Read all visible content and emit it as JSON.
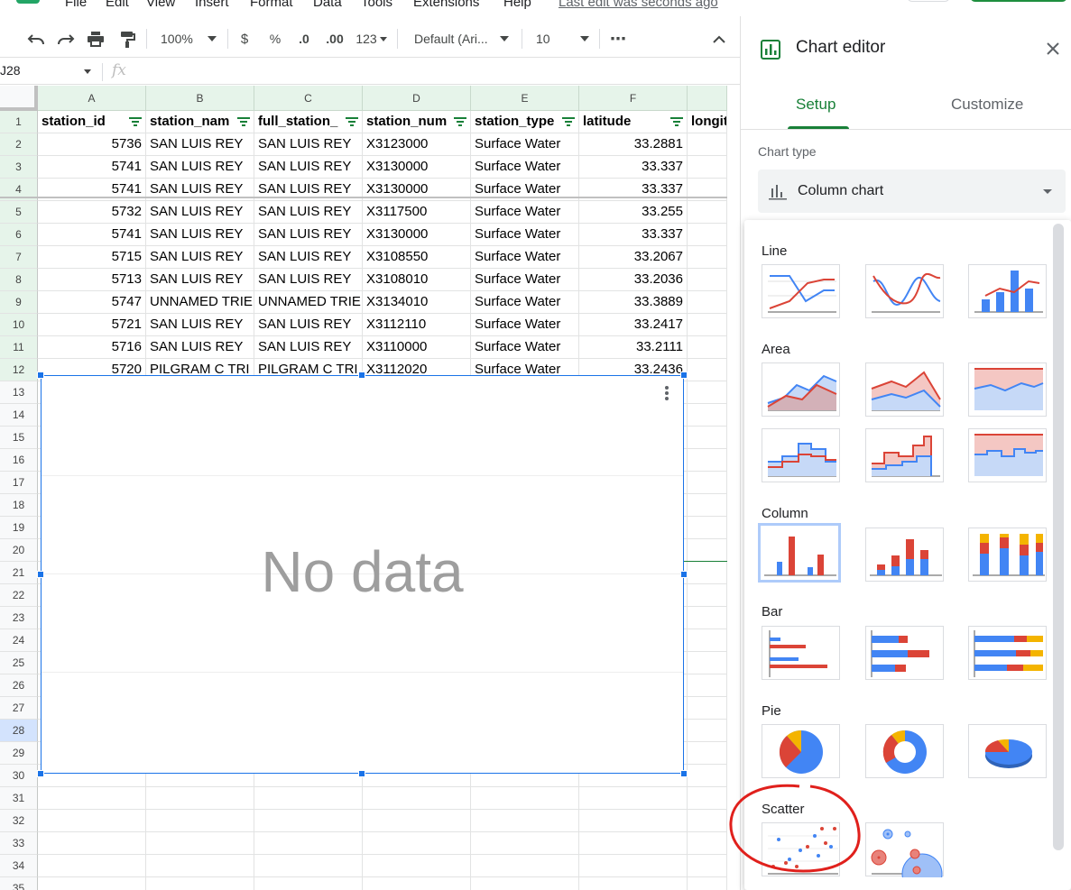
{
  "menu": {
    "items": [
      "File",
      "Edit",
      "View",
      "Insert",
      "Format",
      "Data",
      "Tools",
      "Extensions",
      "Help"
    ],
    "last_edit": "Last edit was seconds ago"
  },
  "toolbar": {
    "zoom": "100%",
    "currency": "$",
    "percent": "%",
    "dec_decrease": ".0",
    "dec_increase": ".00",
    "more_formats": "123",
    "font": "Default (Ari...",
    "font_size": "10",
    "more": "⋯"
  },
  "formula_bar": {
    "cell_ref": "J28",
    "fx": "fx",
    "value": ""
  },
  "grid": {
    "columns": [
      "A",
      "B",
      "C",
      "D",
      "E",
      "F"
    ],
    "headers": [
      "station_id",
      "station_nam",
      "full_station_",
      "station_num",
      "station_type",
      "latitude",
      "longit"
    ],
    "rows": [
      [
        "5736",
        "SAN LUIS REY",
        "SAN LUIS REY",
        "X3123000",
        "Surface Water",
        "33.2881"
      ],
      [
        "5741",
        "SAN LUIS REY",
        "SAN LUIS REY",
        "X3130000",
        "Surface Water",
        "33.337"
      ],
      [
        "5741",
        "SAN LUIS REY",
        "SAN LUIS REY",
        "X3130000",
        "Surface Water",
        "33.337"
      ],
      [
        "5732",
        "SAN LUIS REY",
        "SAN LUIS REY",
        "X3117500",
        "Surface Water",
        "33.255"
      ],
      [
        "5741",
        "SAN LUIS REY",
        "SAN LUIS REY",
        "X3130000",
        "Surface Water",
        "33.337"
      ],
      [
        "5715",
        "SAN LUIS REY",
        "SAN LUIS REY",
        "X3108550",
        "Surface Water",
        "33.2067"
      ],
      [
        "5713",
        "SAN LUIS REY",
        "SAN LUIS REY",
        "X3108010",
        "Surface Water",
        "33.2036"
      ],
      [
        "5747",
        "UNNAMED TRIE",
        "UNNAMED TRIE",
        "X3134010",
        "Surface Water",
        "33.3889"
      ],
      [
        "5721",
        "SAN LUIS REY",
        "SAN LUIS REY",
        "X3112110",
        "Surface Water",
        "33.2417"
      ],
      [
        "5716",
        "SAN LUIS REY",
        "SAN LUIS REY",
        "X3110000",
        "Surface Water",
        "33.2111"
      ],
      [
        "5720",
        "PILGRAM C TRI",
        "PILGRAM C TRI",
        "X3112020",
        "Surface Water",
        "33.2436"
      ]
    ],
    "row_numbers": [
      "1",
      "2",
      "3",
      "4",
      "5",
      "6",
      "7",
      "8",
      "9",
      "10",
      "11",
      "12",
      "13",
      "14",
      "15",
      "16",
      "17",
      "18",
      "19",
      "20",
      "21",
      "22",
      "23",
      "24",
      "25",
      "26",
      "27",
      "28",
      "29",
      "30",
      "31",
      "32",
      "33",
      "34",
      "35"
    ]
  },
  "chart": {
    "message": "No data"
  },
  "chart_editor": {
    "title": "Chart editor",
    "tabs": [
      "Setup",
      "Customize"
    ],
    "chart_type_label": "Chart type",
    "chart_type_value": "Column chart",
    "categories": [
      "Line",
      "Area",
      "Column",
      "Bar",
      "Pie",
      "Scatter"
    ]
  },
  "colors": {
    "accent_green": "#188038",
    "selection_blue": "#1a73e8",
    "series_blue": "#4285f4",
    "series_red": "#db4437",
    "series_yellow": "#f4b400",
    "annotation_red": "#e0201c"
  }
}
